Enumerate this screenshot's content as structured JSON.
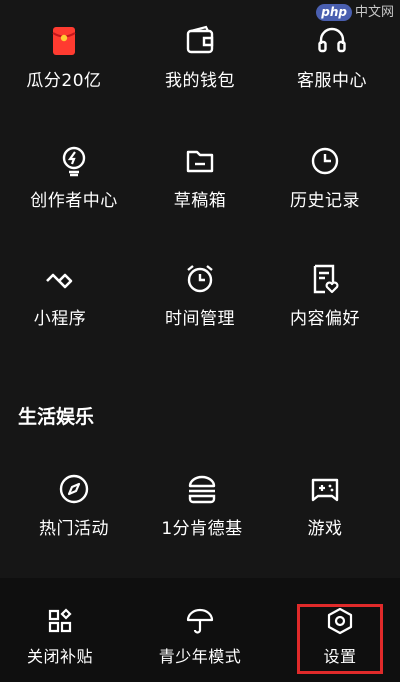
{
  "watermark": {
    "badge": "php",
    "text": "中文网"
  },
  "grid": {
    "row1": [
      {
        "label": "瓜分20亿",
        "icon": "red-envelope-icon",
        "accent": "#ff3b30"
      },
      {
        "label": "我的钱包",
        "icon": "wallet-icon"
      },
      {
        "label": "客服中心",
        "icon": "headset-icon"
      }
    ],
    "row2": [
      {
        "label": "创作者中心",
        "icon": "lightbulb-icon"
      },
      {
        "label": "草稿箱",
        "icon": "folder-icon"
      },
      {
        "label": "历史记录",
        "icon": "clock-icon"
      }
    ],
    "row3": [
      {
        "label": "小程序",
        "icon": "mini-program-icon"
      },
      {
        "label": "时间管理",
        "icon": "alarm-clock-icon"
      },
      {
        "label": "内容偏好",
        "icon": "document-heart-icon"
      }
    ]
  },
  "entertainment": {
    "title": "生活娱乐",
    "items": [
      {
        "label": "热门活动",
        "icon": "compass-icon"
      },
      {
        "label": "1分肯德基",
        "icon": "burger-icon"
      },
      {
        "label": "游戏",
        "icon": "gamepad-icon"
      }
    ]
  },
  "bottom_bar": {
    "items": [
      {
        "label": "关闭补贴",
        "icon": "apps-grid-icon"
      },
      {
        "label": "青少年模式",
        "icon": "umbrella-icon"
      },
      {
        "label": "设置",
        "icon": "hexagon-settings-icon"
      }
    ],
    "highlight_color": "#e02a2a"
  }
}
